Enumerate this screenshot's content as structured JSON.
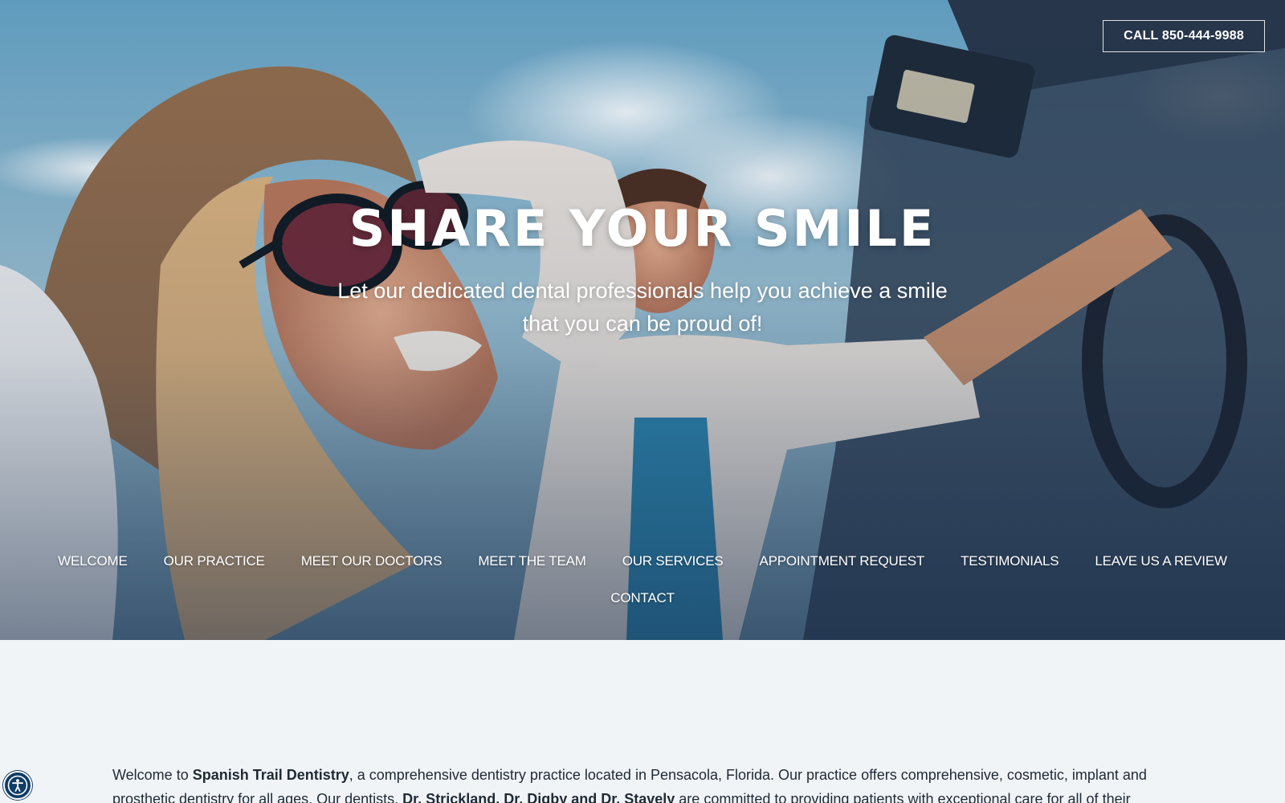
{
  "header": {
    "call_button": "CALL 850-444-9988"
  },
  "hero": {
    "headline": "SHARE YOUR SMILE",
    "subheadline": "Let our dedicated dental professionals help you achieve a smile that you can be proud of!"
  },
  "nav": {
    "items": [
      "WELCOME",
      "OUR PRACTICE",
      "MEET OUR DOCTORS",
      "MEET THE TEAM",
      "OUR SERVICES",
      "APPOINTMENT REQUEST",
      "TESTIMONIALS",
      "LEAVE US A REVIEW",
      "CONTACT"
    ]
  },
  "intro": {
    "p1": "Welcome to ",
    "practice_name": "Spanish Trail Dentistry",
    "p2": ", a comprehensive dentistry practice located in Pensacola, Florida. Our practice offers comprehensive, cosmetic, implant and prosthetic dentistry for all ages. Our dentists, ",
    "doctors": "Dr. Strickland, Dr. Digby and Dr. Stavely",
    "p3": " are committed to providing patients with exceptional care for all of their dental"
  },
  "accessibility": {
    "icon": "accessibility-icon"
  },
  "colors": {
    "page_background": "#f1f4f7",
    "text": "#1f2a35",
    "accessibility_button": "#0f3d66"
  }
}
